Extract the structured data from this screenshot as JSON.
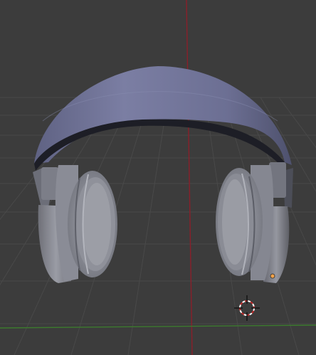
{
  "viewport": {
    "kind": "3d-viewport",
    "object_name": "",
    "background_color": "#3c3c3c",
    "grid_color": "#4a4a4a",
    "axis_colors": {
      "x": "#3c7a2e",
      "y": "#8a1f2a"
    },
    "model_colors": {
      "headband": "#73769a",
      "earcup": "#8c8e98",
      "origin_dot": "#f0a24a"
    },
    "show_grid": true,
    "show_3d_cursor": true,
    "show_object_origin": true
  },
  "icons": {
    "cursor": "3d-cursor-icon",
    "origin": "object-origin-dot"
  }
}
